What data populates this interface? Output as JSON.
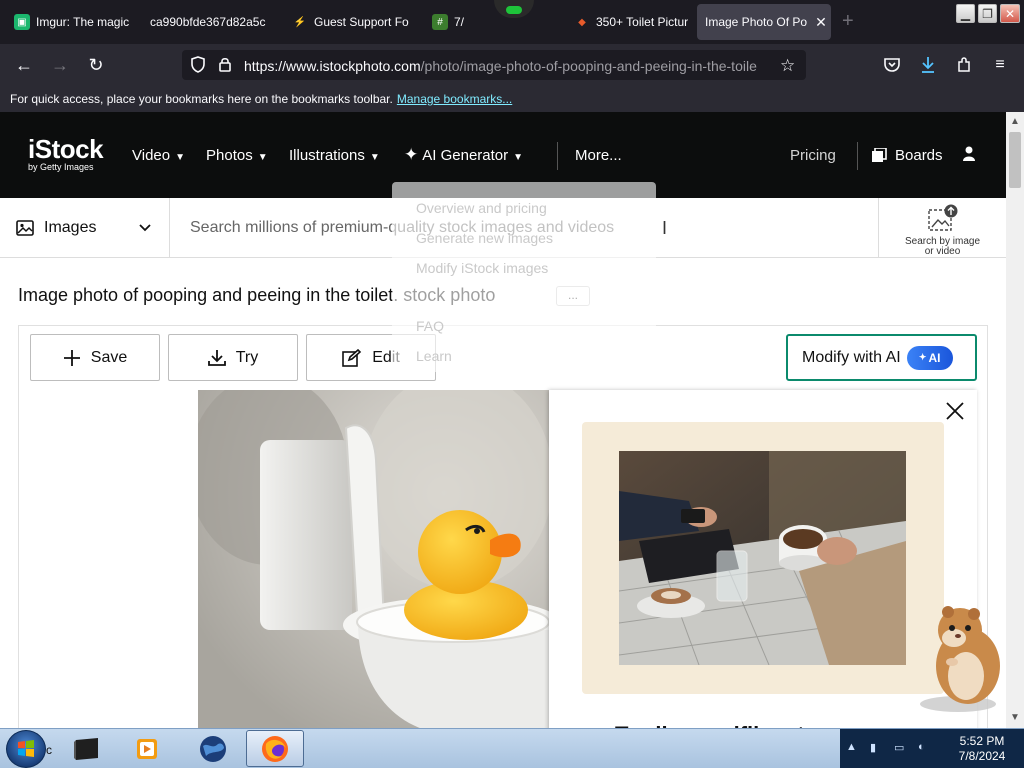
{
  "browser": {
    "tabs": [
      {
        "label": "Imgur: The magic",
        "fav_color": "#1bb76e",
        "active": false
      },
      {
        "label": "ca990bfde367d82a5c",
        "fav_color": "#2b2a33",
        "active": false
      },
      {
        "label": "Guest Support Fo",
        "fav_color": "#e8a33d",
        "active": false
      },
      {
        "label": "7/",
        "fav_color": "#3c7d2e",
        "active": false
      },
      {
        "label": "350+ Toilet Pictur",
        "fav_color": "#e85b2b",
        "active": false
      },
      {
        "label": "Image Photo Of Po",
        "fav_color": "#42414d",
        "active": true
      }
    ],
    "url_host": "https://www.istockphoto.com",
    "url_path": "/photo/image-photo-of-pooping-and-peeing-in-the-toile",
    "bookmarks_text": "For quick access, place your bookmarks here on the bookmarks toolbar.",
    "bookmarks_link": "Manage bookmarks..."
  },
  "site": {
    "logo": "iStock",
    "logo_sub": "by Getty Images",
    "nav": {
      "video": "Video",
      "photos": "Photos",
      "illustrations": "Illustrations",
      "ai_generator": "AI Generator",
      "more": "More...",
      "pricing": "Pricing",
      "boards": "Boards"
    },
    "ai_dropdown": [
      "Overview and pricing",
      "Generate new images",
      "Modify iStock images",
      "FAQ",
      "Learn"
    ]
  },
  "search": {
    "type": "Images",
    "placeholder": "Search millions of premium-quality stock images and videos",
    "by_image_line1": "Search by image",
    "by_image_line2": "or video"
  },
  "asset": {
    "title": "Image photo of pooping and peeing in the toilet. stock photo",
    "more_chip": "...",
    "save": "Save",
    "try": "Try",
    "edit": "Edit",
    "modify": "Modify with AI",
    "ai_badge": "AI"
  },
  "popup": {
    "heading": "Tradicar uniflianst"
  },
  "taskbar": {
    "start_label": "c",
    "time": "5:52 PM",
    "date": "7/8/2024"
  },
  "colors": {
    "header_bg": "#0c0d0d",
    "modify_border": "#0b8a6c",
    "ai_badge": "#1a56db",
    "promo_bg": "#f5ebd8"
  }
}
